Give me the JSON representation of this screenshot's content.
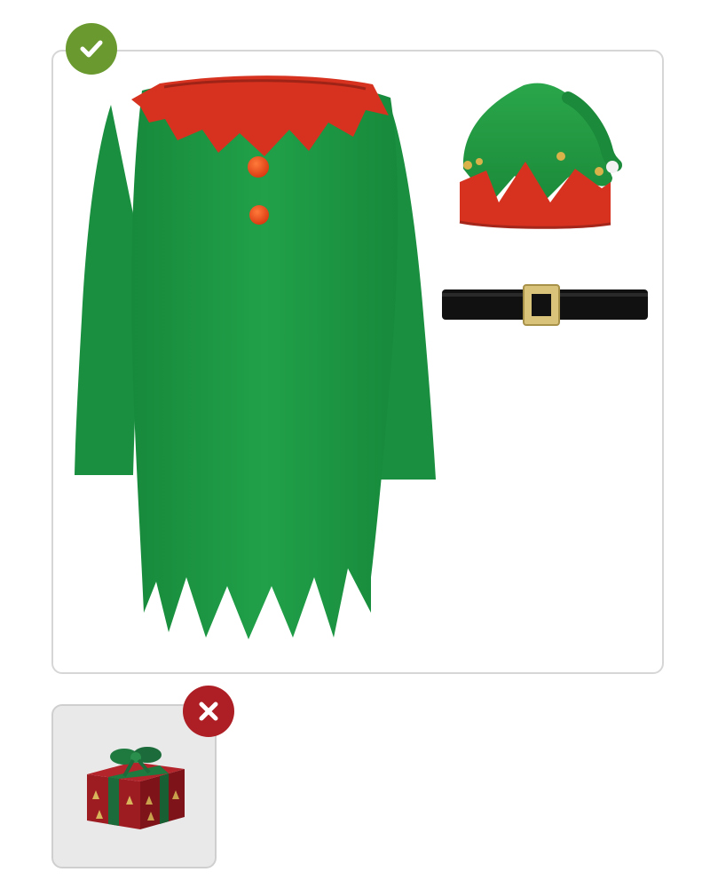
{
  "included": {
    "status": "included",
    "badge_icon": "checkmark-icon",
    "badge_color": "#6a9a2f",
    "items": [
      "elf-dress-image",
      "elf-hat-image",
      "black-belt-image"
    ]
  },
  "excluded": {
    "status": "not-included",
    "badge_icon": "cross-icon",
    "badge_color": "#ad1f24",
    "items": [
      "gift-box-image"
    ]
  },
  "colors": {
    "felt_green": "#1f9644",
    "felt_red": "#d6321f",
    "belt_black": "#111111",
    "buckle_gold": "#d9c27a"
  }
}
